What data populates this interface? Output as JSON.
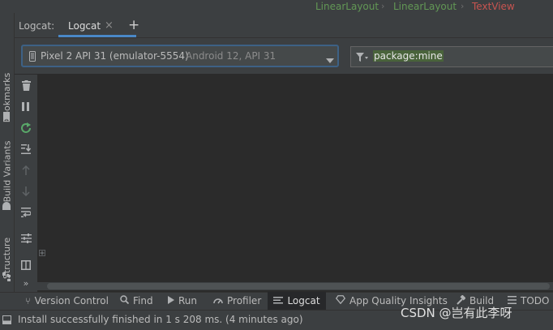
{
  "breadcrumb": {
    "items": [
      "LinearLayout",
      "LinearLayout",
      "TextView"
    ],
    "colors": [
      "#629755",
      "#629755",
      "#c75450"
    ]
  },
  "left_stripe": {
    "tabs": [
      "Bookmarks",
      "Build Variants",
      "Structure"
    ]
  },
  "logcat_header": {
    "title": "Logcat:",
    "tab_label": "Logcat",
    "close_glyph": "×",
    "add_glyph": "+"
  },
  "device_selector": {
    "device": "Pixel 2 API 31 (emulator-5554)",
    "detail": "Android 12, API 31"
  },
  "filter": {
    "value": "package:mine"
  },
  "bottom_tools": {
    "version_control": "Version Control",
    "find": "Find",
    "run": "Run",
    "profiler": "Profiler",
    "logcat": "Logcat",
    "app_quality": "App Quality Insights",
    "build": "Build",
    "todo": "TODO"
  },
  "status_bar": {
    "message": "Install successfully finished in 1 s 208 ms. (4 minutes ago)"
  },
  "watermark": "CSDN @岂有此李呀",
  "colors": {
    "accent_blue": "#3d6185",
    "tab_underline": "#4a88c7",
    "filter_highlight": "#49633b",
    "green_icon": "#59a869"
  }
}
